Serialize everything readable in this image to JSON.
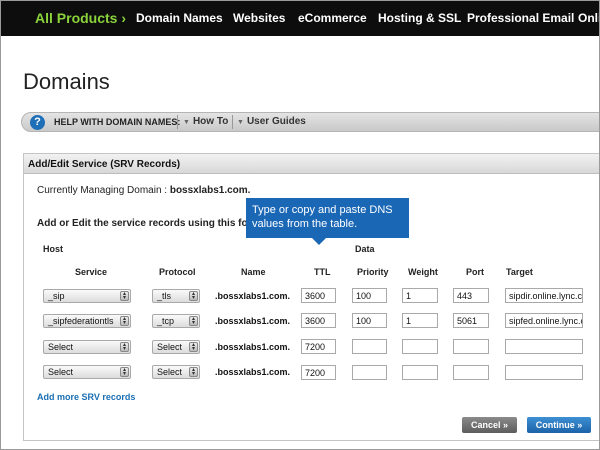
{
  "topnav": {
    "all_products": "All Products",
    "all_products_chevron": "›",
    "items": [
      "Domain Names",
      "Websites",
      "eCommerce",
      "Hosting & SSL",
      "Professional Email",
      "Onlin"
    ]
  },
  "page_title": "Domains",
  "helpbar": {
    "icon": "?",
    "label": "HELP WITH DOMAIN NAMES:",
    "links": [
      "How To",
      "User Guides"
    ]
  },
  "panel": {
    "title": "Add/Edit Service (SRV Records)",
    "managing_label": "Currently Managing Domain :",
    "managing_domain": "bossxlabs1.com.",
    "form_label": "Add or Edit the service records using this form",
    "host_label": "Host",
    "data_label": "Data",
    "columns": [
      "Service",
      "Protocol",
      "Name",
      "TTL",
      "Priority",
      "Weight",
      "Port",
      "Target"
    ],
    "rows": [
      {
        "service": "_sip",
        "protocol": "_tls",
        "name": ".bossxlabs1.com.",
        "ttl": "3600",
        "priority": "100",
        "weight": "1",
        "port": "443",
        "target": "sipdir.online.lync.co"
      },
      {
        "service": "_sipfederationtls",
        "protocol": "_tcp",
        "name": ".bossxlabs1.com.",
        "ttl": "3600",
        "priority": "100",
        "weight": "1",
        "port": "5061",
        "target": "sipfed.online.lync.co"
      },
      {
        "service": "Select",
        "protocol": "Select",
        "name": ".bossxlabs1.com.",
        "ttl": "7200",
        "priority": "",
        "weight": "",
        "port": "",
        "target": ""
      },
      {
        "service": "Select",
        "protocol": "Select",
        "name": ".bossxlabs1.com.",
        "ttl": "7200",
        "priority": "",
        "weight": "",
        "port": "",
        "target": ""
      }
    ],
    "add_more": "Add more SRV records",
    "cancel": "Cancel »",
    "continue": "Continue »"
  },
  "tooltip": "Type or copy and paste DNS values from the table.",
  "colors": {
    "nav_bg": "#0d0d0d",
    "accent_green": "#8ad33b",
    "tooltip_blue": "#1a67b6",
    "link_blue": "#1a6fb3"
  }
}
